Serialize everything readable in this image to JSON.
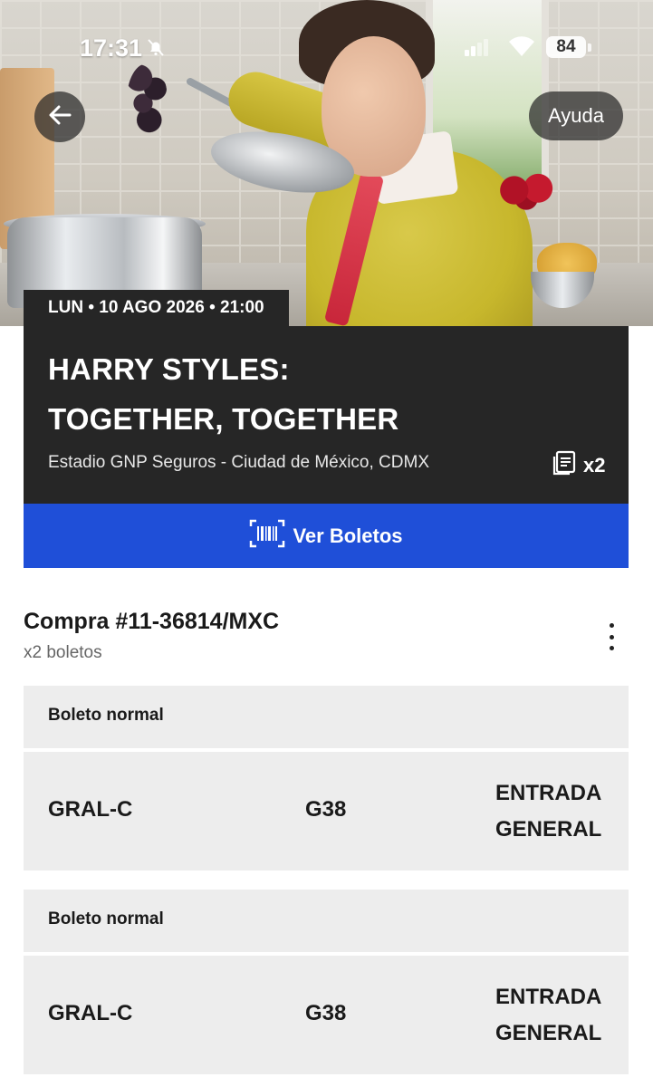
{
  "status_bar": {
    "time": "17:31",
    "battery": "84"
  },
  "header": {
    "help_label": "Ayuda"
  },
  "event": {
    "date_line": "LUN • 10 AGO 2026 • 21:00",
    "title_line1": "HARRY STYLES:",
    "title_line2": "TOGETHER, TOGETHER",
    "venue": "Estadio GNP Seguros - Ciudad de México, CDMX",
    "ticket_count": "x2",
    "view_tickets_label": "Ver Boletos"
  },
  "purchase": {
    "title": "Compra #11-36814/MXC",
    "subtitle": "x2 boletos",
    "tickets": [
      {
        "type": "Boleto normal",
        "section": "GRAL-C",
        "seat": "G38",
        "access_line1": "ENTRADA",
        "access_line2": "GENERAL"
      },
      {
        "type": "Boleto normal",
        "section": "GRAL-C",
        "seat": "G38",
        "access_line1": "ENTRADA",
        "access_line2": "GENERAL"
      }
    ]
  },
  "colors": {
    "card_dark": "#262626",
    "button_blue": "#1f4fd8",
    "ticket_bg": "#ededed"
  },
  "icons": [
    "bell-muted-icon",
    "cellular-signal-icon",
    "wifi-icon",
    "battery-icon",
    "back-arrow-icon",
    "ticket-stack-icon",
    "barcode-icon",
    "more-vertical-icon"
  ]
}
